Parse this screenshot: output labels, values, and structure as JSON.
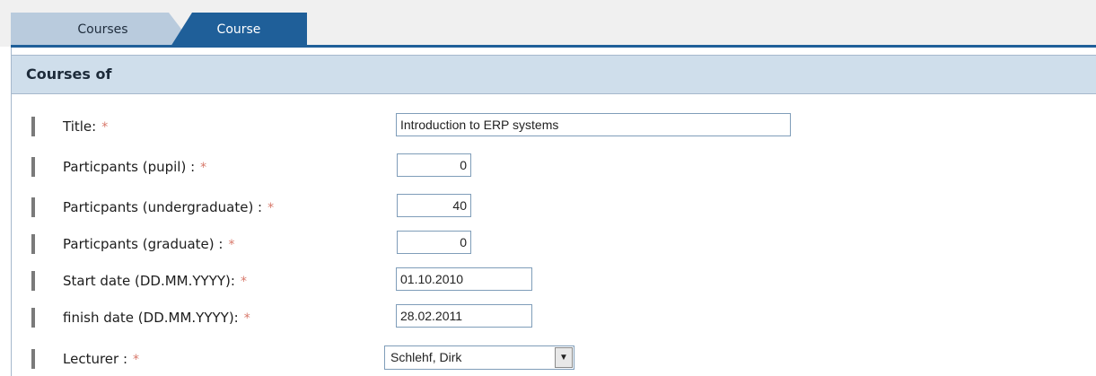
{
  "tabs": [
    {
      "label": "Courses"
    },
    {
      "label": "Course"
    }
  ],
  "panel": {
    "title": "Courses of"
  },
  "form": {
    "required_marker": "*",
    "fields": [
      {
        "label": "Title:",
        "value": "Introduction to ERP systems"
      },
      {
        "label": "Particpants (pupil) :",
        "value": "0"
      },
      {
        "label": "Particpants (undergraduate) :",
        "value": "40"
      },
      {
        "label": "Particpants (graduate) :",
        "value": "0"
      },
      {
        "label": "Start date (DD.MM.YYYY):",
        "value": "01.10.2010"
      },
      {
        "label": "finish date (DD.MM.YYYY):",
        "value": "28.02.2011"
      },
      {
        "label": "Lecturer :",
        "value": "Schlehf, Dirk"
      }
    ]
  },
  "icons": {
    "dropdown": "dropdown-arrow-icon"
  },
  "colors": {
    "tab_active": "#1f5f99",
    "tab_inactive": "#b9cbdd",
    "panel_header": "#cfdeeb",
    "required": "#d8786a"
  }
}
